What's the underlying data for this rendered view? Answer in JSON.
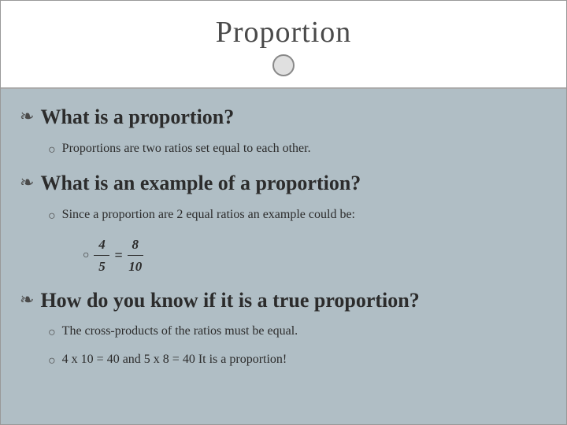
{
  "title": "Proportion",
  "sections": [
    {
      "id": "what-is",
      "heading": "What is a proportion?",
      "bullet_symbol": "❧",
      "children": [
        {
          "text": "Proportions are two ratios set equal to each other.",
          "symbol": "○"
        }
      ]
    },
    {
      "id": "what-example",
      "heading": "What is an example of a proportion?",
      "bullet_symbol": "❧",
      "children": [
        {
          "text": "Since a proportion are 2 equal ratios an example could be:",
          "symbol": "○",
          "sub": [
            {
              "type": "fraction",
              "numerator1": "4",
              "denominator1": "5",
              "numerator2": "8",
              "denominator2": "10"
            }
          ]
        }
      ]
    },
    {
      "id": "how-know",
      "heading": "How do you know if it is a true proportion?",
      "bullet_symbol": "❧",
      "children": [
        {
          "text": "The cross-products of the ratios must be equal.",
          "symbol": "○"
        },
        {
          "text": "4 x 10 = 40  and  5 x 8 = 40  It is a proportion!",
          "symbol": "○"
        }
      ]
    }
  ]
}
